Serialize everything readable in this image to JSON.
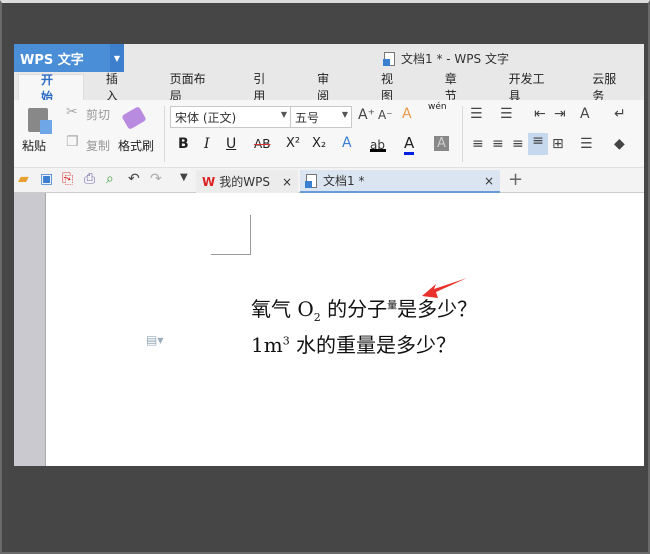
{
  "app": {
    "logo": "WPS 文字",
    "window_title": "文档1 * - WPS 文字"
  },
  "menu_tabs": [
    "开始",
    "插入",
    "页面布局",
    "引用",
    "审阅",
    "视图",
    "章节",
    "开发工具",
    "云服务"
  ],
  "ribbon": {
    "paste": "粘贴",
    "cut": "剪切",
    "copy": "复制",
    "format_painter": "格式刷",
    "font_name": "宋体 (正文)",
    "font_size": "五号",
    "bold": "B",
    "italic": "I",
    "underline": "U",
    "strike": "AB",
    "superscript": "X²",
    "subscript": "X₂",
    "font_color": "A",
    "char_shade": "A",
    "pinyin": "wén"
  },
  "doc_tabs": [
    {
      "label": "我的WPS"
    },
    {
      "label": "文档1 *"
    }
  ],
  "document": {
    "line1_a": "氧气 O",
    "line1_sub": "2",
    "line1_b": " 的分子",
    "line1_sup": "量",
    "line1_c": "是多少？",
    "line2_a": "1m",
    "line2_sup": "3",
    "line2_b": " 水的重量是多少？"
  },
  "colors": {
    "accent": "#4a8ed8",
    "arrow": "#e8312a"
  }
}
